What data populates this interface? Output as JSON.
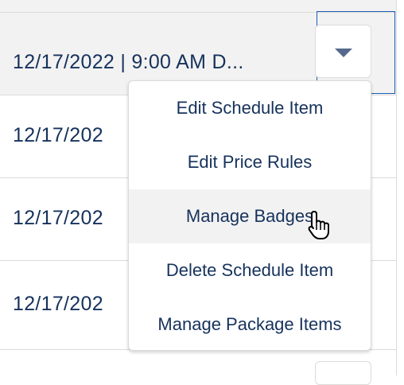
{
  "rows": [
    {
      "label": "12/17/2022 | 9:00 AM D..."
    },
    {
      "label": "12/17/202"
    },
    {
      "label": "12/17/202"
    },
    {
      "label": "12/17/202"
    }
  ],
  "dropdown": {
    "items": [
      {
        "label": "Edit Schedule Item"
      },
      {
        "label": "Edit Price Rules"
      },
      {
        "label": "Manage Badges",
        "hovered": true
      },
      {
        "label": "Delete Schedule Item"
      },
      {
        "label": "Manage Package Items"
      }
    ]
  },
  "icons": {
    "menu_button": "chevron-down-icon",
    "pointer": "hand-pointer-icon"
  },
  "colors": {
    "text": "#16325c",
    "focus_border": "#1b5fb5",
    "hover_bg": "#f3f2f2",
    "border": "#dddbda"
  }
}
